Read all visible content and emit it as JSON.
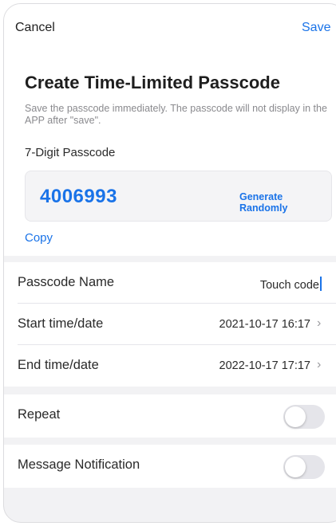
{
  "nav": {
    "cancel_label": "Cancel",
    "save_label": "Save"
  },
  "title": "Create Time-Limited Passcode",
  "note": "Save the passcode immediately. The passcode will not display in the APP after \"save\".",
  "passcode": {
    "label": "7-Digit Passcode",
    "value": "4006993",
    "generate_label": "Generate Randomly",
    "copy_label": "Copy"
  },
  "fields": {
    "name": {
      "label": "Passcode Name",
      "value": "Touch code"
    },
    "start": {
      "label": "Start time/date",
      "value": "2021-10-17 16:17"
    },
    "end": {
      "label": "End time/date",
      "value": "2022-10-17 17:17"
    },
    "repeat": {
      "label": "Repeat",
      "on": false
    },
    "notification": {
      "label": "Message Notification",
      "on": false
    }
  },
  "colors": {
    "accent": "#1a73e8",
    "background": "#f2f2f4",
    "toggle_off": "#e5e5ea"
  },
  "icons": {
    "chevron": "chevron-right-icon"
  }
}
